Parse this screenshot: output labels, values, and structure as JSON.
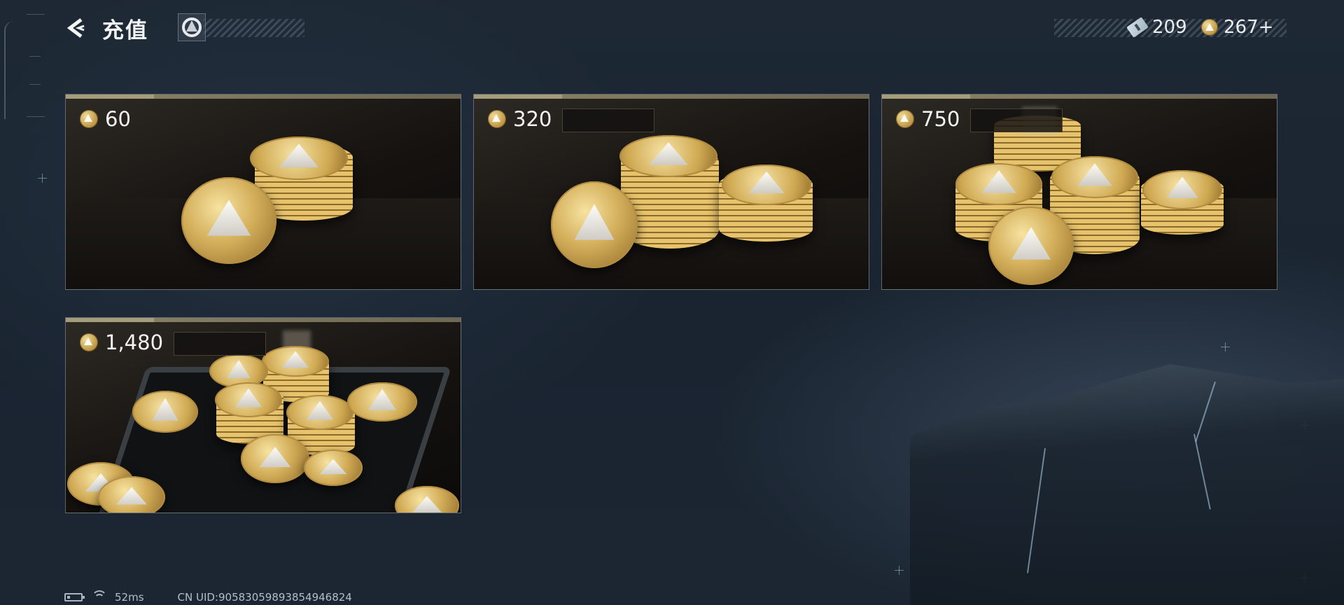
{
  "header": {
    "title": "充值",
    "back_icon": "chevron-left-icon",
    "brand_icon": "brand-logo-icon"
  },
  "wallet": {
    "coupons": "209",
    "coins": "267+"
  },
  "products": [
    {
      "amount": "60"
    },
    {
      "amount": "320"
    },
    {
      "amount": "750"
    },
    {
      "amount": "1,480"
    }
  ],
  "status_bar": {
    "ping": "52ms",
    "uid": "CN UID:905830598938549468​24"
  },
  "colors": {
    "background": "#1b2531",
    "card_border": "#8c8467",
    "gold": "#d3ae5a"
  }
}
